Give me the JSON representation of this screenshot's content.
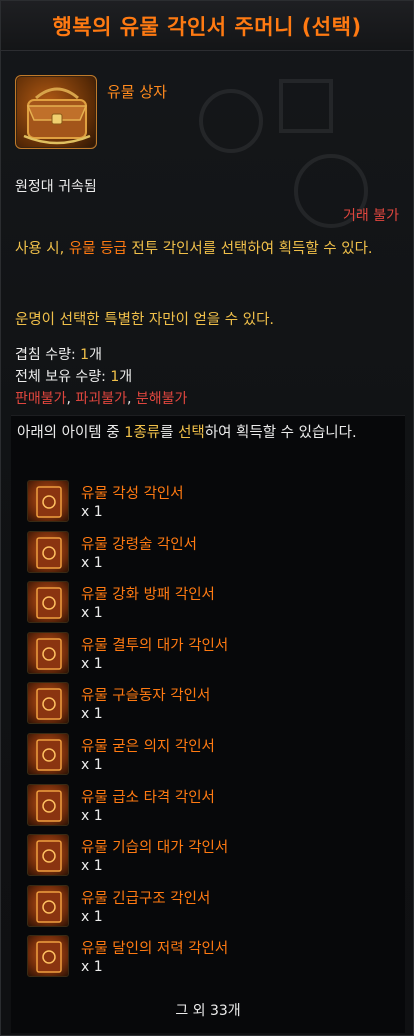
{
  "tooltip": {
    "title": "행복의 유물 각인서 주머니 (선택)",
    "grade": "유물 상자",
    "bound": "원정대 귀속됨",
    "trade": "거래 불가",
    "desc1_pre": "사용 시, ",
    "desc1_hl": "유물 등급",
    "desc1_post": " 전투 각인서를 선택하여 획득할 수 있다.",
    "desc2": "운명이 선택한 특별한 자만이 얻을 수 있다.",
    "stack_label": "겹침 수량: ",
    "stack_value": "1",
    "stack_unit": "개",
    "owned_label": "전체 보유 수량: ",
    "owned_value": "1",
    "owned_unit": "개",
    "restrict1": "판매불가",
    "restrict2": "파괴불가",
    "restrict3": "분해불가",
    "sep": ", "
  },
  "selection": {
    "head_pre": "아래의 아이템 중 ",
    "head_count": "1종류",
    "head_mid": "를 ",
    "head_select": "선택",
    "head_post": "하여 획득할 수 있습니다.",
    "items": [
      {
        "name": "유물 각성 각인서",
        "qty": "x 1"
      },
      {
        "name": "유물 강령술 각인서",
        "qty": "x 1"
      },
      {
        "name": "유물 강화 방패 각인서",
        "qty": "x 1"
      },
      {
        "name": "유물 결투의 대가 각인서",
        "qty": "x 1"
      },
      {
        "name": "유물 구슬동자 각인서",
        "qty": "x 1"
      },
      {
        "name": "유물 굳은 의지 각인서",
        "qty": "x 1"
      },
      {
        "name": "유물 급소 타격 각인서",
        "qty": "x 1"
      },
      {
        "name": "유물 기습의 대가 각인서",
        "qty": "x 1"
      },
      {
        "name": "유물 긴급구조 각인서",
        "qty": "x 1"
      },
      {
        "name": "유물 달인의 저력 각인서",
        "qty": "x 1"
      }
    ],
    "more": "그 외 33개"
  },
  "colors": {
    "accent": "#ff7a12",
    "yellow": "#f0c04a",
    "red": "#e0463e"
  },
  "icons": {
    "item": "satchel-icon",
    "entry": "engraving-book-icon"
  }
}
